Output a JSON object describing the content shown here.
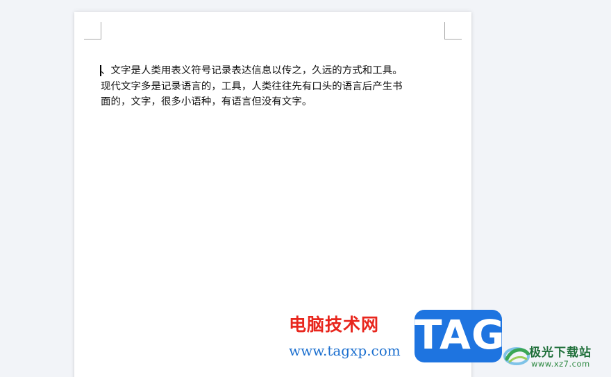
{
  "document": {
    "lines": [
      "、文字是人类用表义符号记录表达信息以传之，久远的方式和工具。",
      "现代文字多是记录语言的，工具，人类往往先有口头的语言后产生书",
      "面的，文字，很多小语种，有语言但没有文字。"
    ]
  },
  "watermark": {
    "site_name": "电脑技术网",
    "site_url": "www.tagxp.com",
    "logo_text": "TAG",
    "logo_color": "#1e74e0",
    "secondary_site_name": "极光下载站",
    "secondary_site_url": "www.xz7.com"
  }
}
